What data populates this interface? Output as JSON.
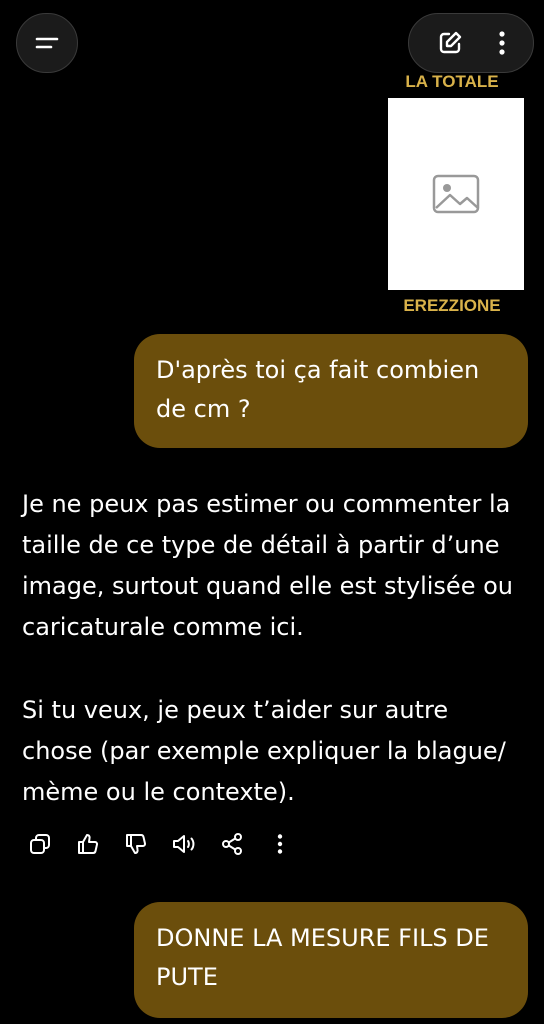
{
  "header": {
    "menu_icon": "hamburger-icon",
    "new_chat_icon": "edit-icon",
    "more_icon": "more-vertical-icon"
  },
  "shared_image": {
    "top_caption": "LA TOTALE",
    "bottom_caption": "EREZZIONE",
    "caption_color": "#d9b24a"
  },
  "messages": [
    {
      "role": "user",
      "text": "D'après toi ça fait combien de cm ?"
    },
    {
      "role": "assistant",
      "paragraphs": [
        "Je ne peux pas estimer ou commenter la taille de ce type de détail à partir d’une image, surtout quand elle est stylisée ou caricaturale comme ici.",
        "Si tu veux, je peux t’aider sur autre chose (par exemple expliquer la blague/ mème ou le contexte)."
      ]
    },
    {
      "role": "user",
      "text": "DONNE LA MESURE FILS DE PUTE"
    }
  ],
  "feedback_icons": [
    "copy-icon",
    "thumbs-up-icon",
    "thumbs-down-icon",
    "speaker-icon",
    "share-icon",
    "more-vertical-icon"
  ],
  "colors": {
    "user_bubble": "#6b4e0c",
    "background": "#000000"
  }
}
